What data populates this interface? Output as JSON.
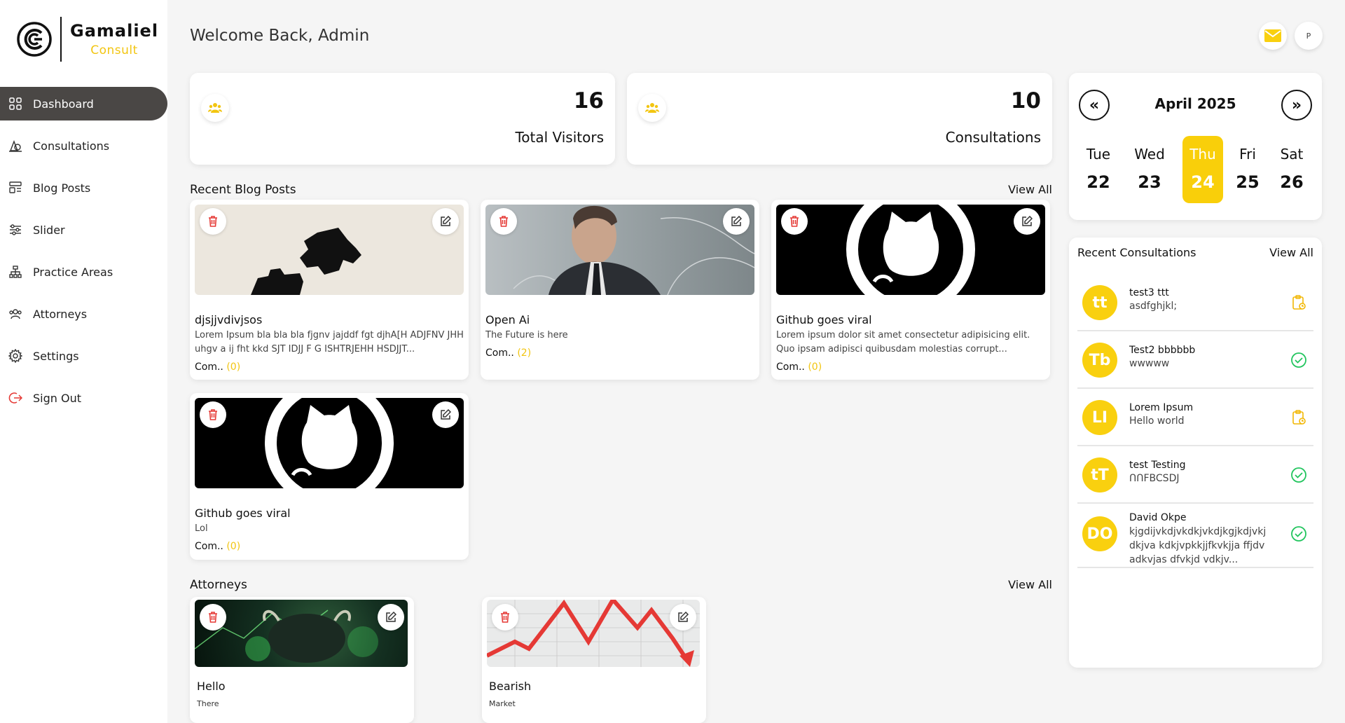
{
  "brand": {
    "name": "Gamaliel",
    "sub": "Consult"
  },
  "sidebar": {
    "items": [
      {
        "label": "Dashboard",
        "icon": "grid-icon",
        "active": true
      },
      {
        "label": "Consultations",
        "icon": "consultation-icon"
      },
      {
        "label": "Blog Posts",
        "icon": "blog-icon"
      },
      {
        "label": "Slider",
        "icon": "slider-icon"
      },
      {
        "label": "Practice Areas",
        "icon": "sitemap-icon"
      },
      {
        "label": "Attorneys",
        "icon": "users-icon"
      },
      {
        "label": "Settings",
        "icon": "gear-icon"
      },
      {
        "label": "Sign Out",
        "icon": "signout-icon"
      }
    ]
  },
  "header": {
    "welcome": "Welcome Back, Admin",
    "avatar_alt": "P"
  },
  "stats": [
    {
      "value": "16",
      "label": "Total Visitors",
      "icon": "users-icon"
    },
    {
      "value": "10",
      "label": "Consultations",
      "icon": "users-icon"
    }
  ],
  "blog": {
    "title": "Recent Blog Posts",
    "view_all": "View All",
    "comments_label": "Com..",
    "posts": [
      {
        "title": "djsjjvdivjsos",
        "excerpt": "Lorem Ipsum bla bla bla fjgnv jajddf fgt djhA[H ADJFNV JHH uhgv a ij fht kkd SJT IDJJ F G ISHTRJEHH HSDJJT...",
        "comments": "(0)",
        "image": "puzzle-image"
      },
      {
        "title": "Open Ai",
        "excerpt": "The Future is here",
        "comments": "(2)",
        "image": "portrait-image"
      },
      {
        "title": "Github goes viral",
        "excerpt": "Lorem ipsum dolor sit amet consectetur adipisicing elit. Quo ipsam adipisci quibusdam molestias corrupt...",
        "comments": "(0)",
        "image": "github-logo-image"
      },
      {
        "title": "Github goes viral",
        "excerpt": "Lol",
        "comments": "(0)",
        "image": "github-logo-image"
      }
    ]
  },
  "attorneys": {
    "title": "Attorneys",
    "view_all": "View All",
    "items": [
      {
        "name": "Hello",
        "desc": "There",
        "image": "bull-image"
      },
      {
        "name": "Bearish",
        "desc": "Market",
        "image": "bearish-chart-image"
      }
    ]
  },
  "calendar": {
    "month": "April 2025",
    "prev": "«",
    "next": "»",
    "days": [
      {
        "name": "Tue",
        "date": "22"
      },
      {
        "name": "Wed",
        "date": "23"
      },
      {
        "name": "Thu",
        "date": "24",
        "selected": true
      },
      {
        "name": "Fri",
        "date": "25"
      },
      {
        "name": "Sat",
        "date": "26"
      }
    ]
  },
  "consultations": {
    "title": "Recent Consultations",
    "view_all": "View All",
    "items": [
      {
        "initials": "tt",
        "name": "test3 ttt",
        "message": "asdfghjkl;",
        "status": "pending"
      },
      {
        "initials": "Tb",
        "name": "Test2 bbbbbb",
        "message": "wwwww",
        "status": "done"
      },
      {
        "initials": "LI",
        "name": "Lorem Ipsum",
        "message": "Hello world",
        "status": "pending"
      },
      {
        "initials": "tT",
        "name": "test Testing",
        "message": "ՈՈFBCSDJ",
        "status": "done"
      },
      {
        "initials": "DO",
        "name": "David Okpe",
        "message": "kjgdijvkdjvkdkjvkdjkgjkdjvkj dkjva kdkjvpkkjjfkvkjja ffjdv adkvjas dfvkjd vdkjv...",
        "status": "done"
      }
    ]
  },
  "colors": {
    "accent": "#f9d00f",
    "active_nav": "#4a4745",
    "delete": "#e53935",
    "done": "#22c55e",
    "pending": "#f2b705"
  }
}
